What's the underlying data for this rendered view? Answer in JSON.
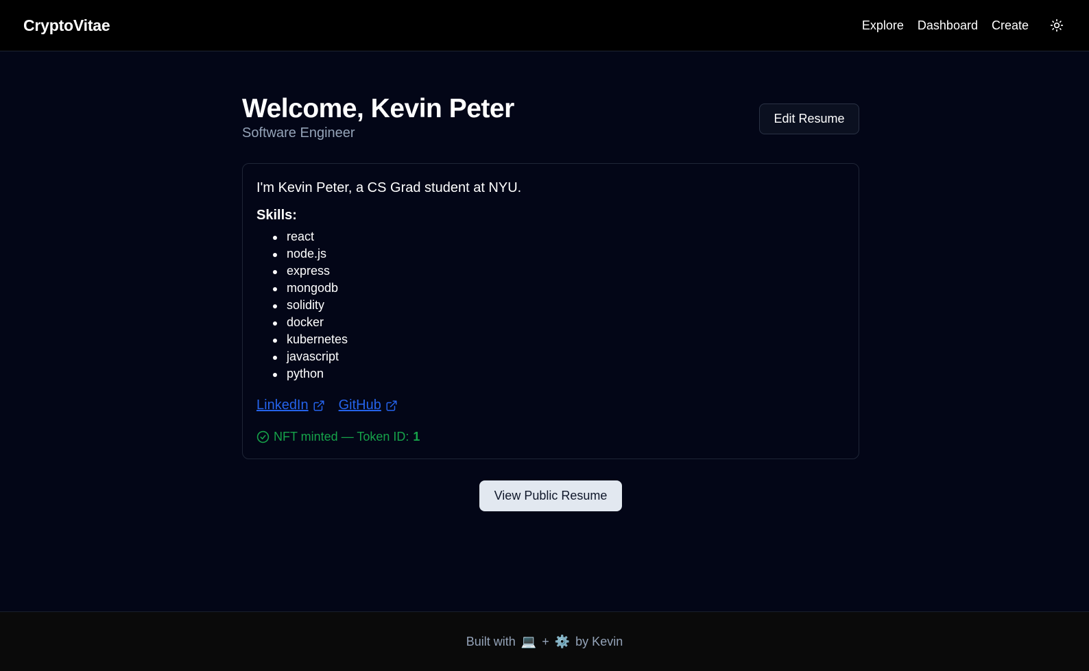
{
  "header": {
    "brand": "CryptoVitae",
    "nav": [
      "Explore",
      "Dashboard",
      "Create"
    ],
    "theme_toggle_icon": "sun-icon"
  },
  "profile": {
    "welcome": "Welcome, Kevin Peter",
    "title": "Software Engineer",
    "edit_label": "Edit Resume"
  },
  "card": {
    "bio": "I'm Kevin Peter, a CS Grad student at NYU.",
    "skills_title": "Skills:",
    "skills": [
      "react",
      "node.js",
      "express",
      "mongodb",
      "solidity",
      "docker",
      "kubernetes",
      "javascript",
      "python"
    ],
    "links": [
      {
        "label": "LinkedIn",
        "icon": "external-link-icon"
      },
      {
        "label": "GitHub",
        "icon": "external-link-icon"
      }
    ],
    "nft": {
      "status": "NFT minted — Token ID:",
      "token_id": "1",
      "icon": "check-circle-icon"
    }
  },
  "actions": {
    "view_public": "View Public Resume"
  },
  "footer": {
    "prefix": "Built with",
    "emoji1": "💻",
    "plus": "+",
    "emoji2": "⚙️",
    "suffix": "by Kevin"
  },
  "colors": {
    "background": "#030617",
    "header_bg": "#000000",
    "link": "#2563eb",
    "success": "#16a34a",
    "muted": "#94a3b8",
    "button_light": "#e2e8f0"
  }
}
